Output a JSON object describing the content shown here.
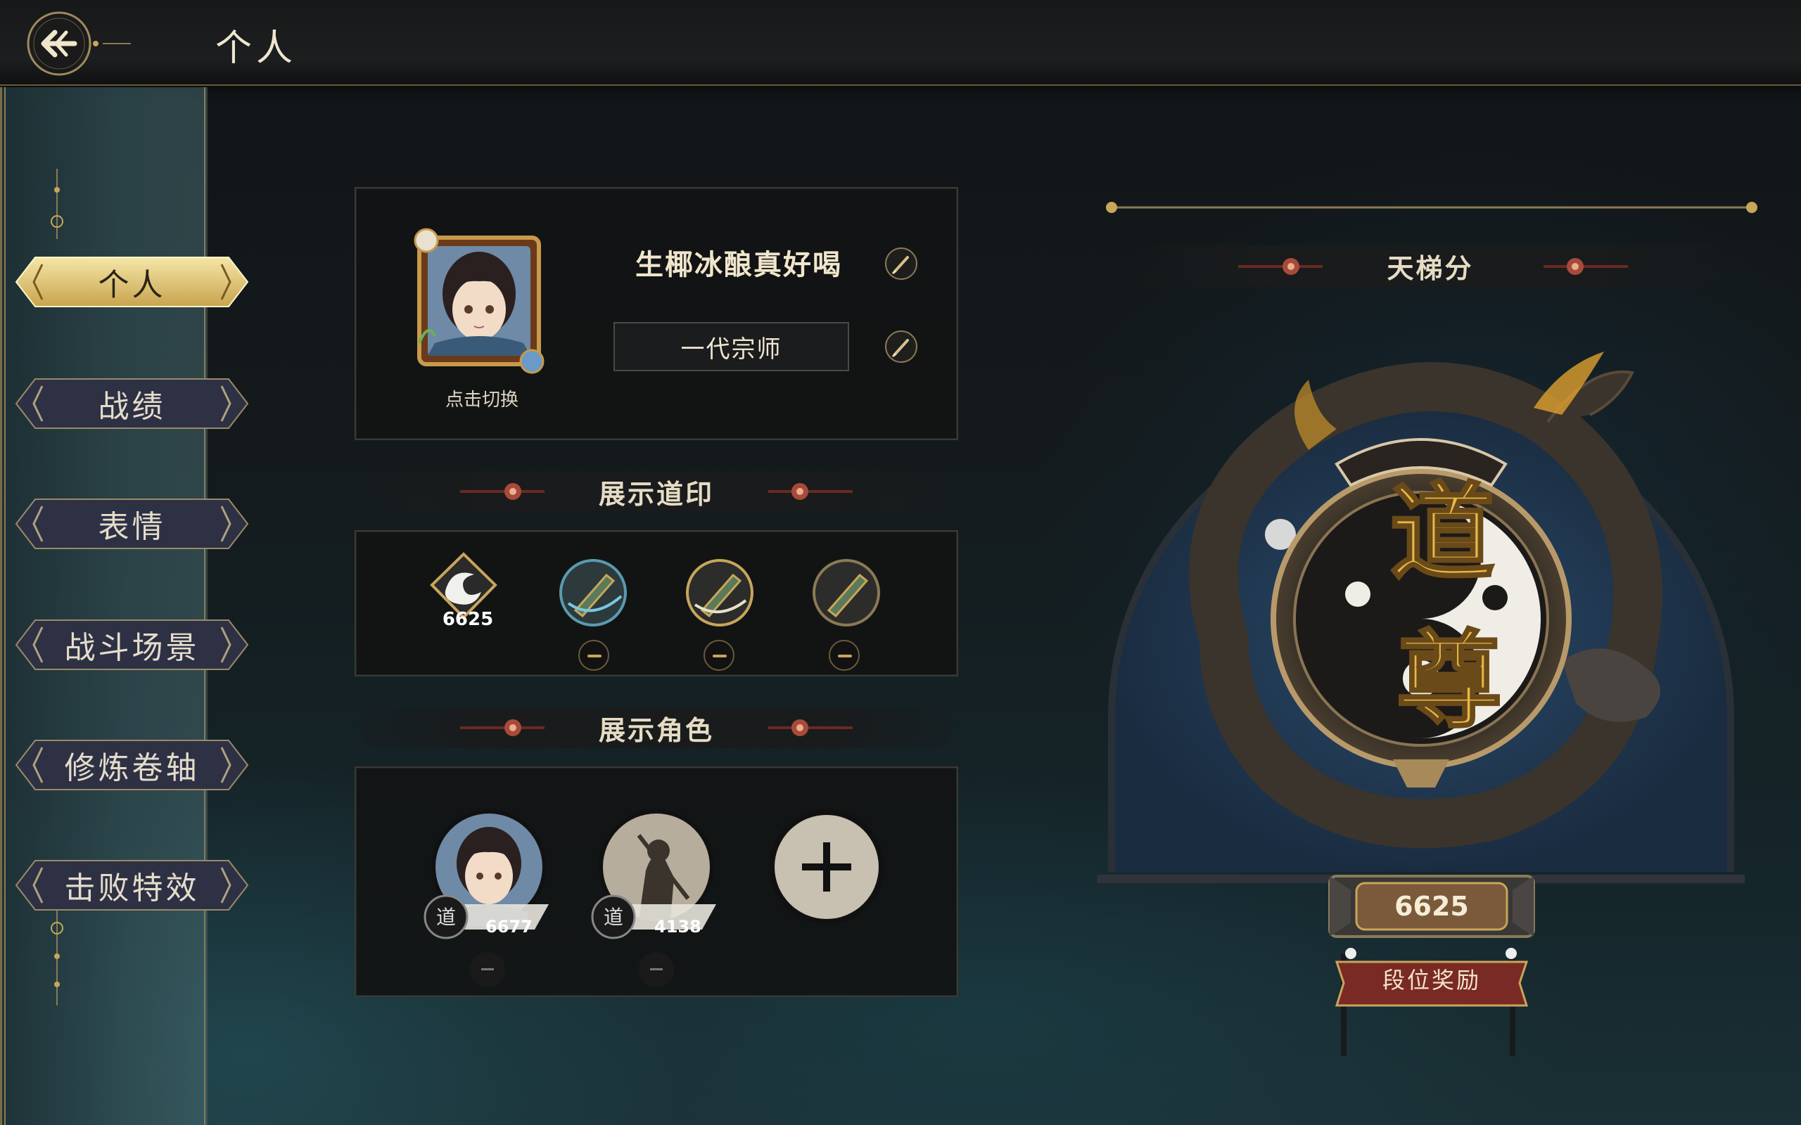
{
  "header": {
    "title": "个人"
  },
  "sidebar": {
    "items": [
      {
        "label": "个人",
        "active": true
      },
      {
        "label": "战绩",
        "active": false
      },
      {
        "label": "表情",
        "active": false
      },
      {
        "label": "战斗场景",
        "active": false
      },
      {
        "label": "修炼卷轴",
        "active": false
      },
      {
        "label": "击败特效",
        "active": false
      }
    ]
  },
  "profile": {
    "name": "生椰冰酿真好喝",
    "title": "一代宗师",
    "avatar_hint": "点击切换"
  },
  "seals": {
    "heading": "展示道印",
    "main_score": "6625"
  },
  "roles": {
    "heading": "展示角色",
    "characters": [
      {
        "score": "6677"
      },
      {
        "score": "4138"
      }
    ]
  },
  "ladder": {
    "heading": "天梯分",
    "rank_glyphs": "道尊",
    "score": "6625",
    "reward_label": "段位奖励"
  },
  "colors": {
    "gold": "#c8a65a",
    "panel": "#121314",
    "accent_red": "#8a3a30"
  }
}
